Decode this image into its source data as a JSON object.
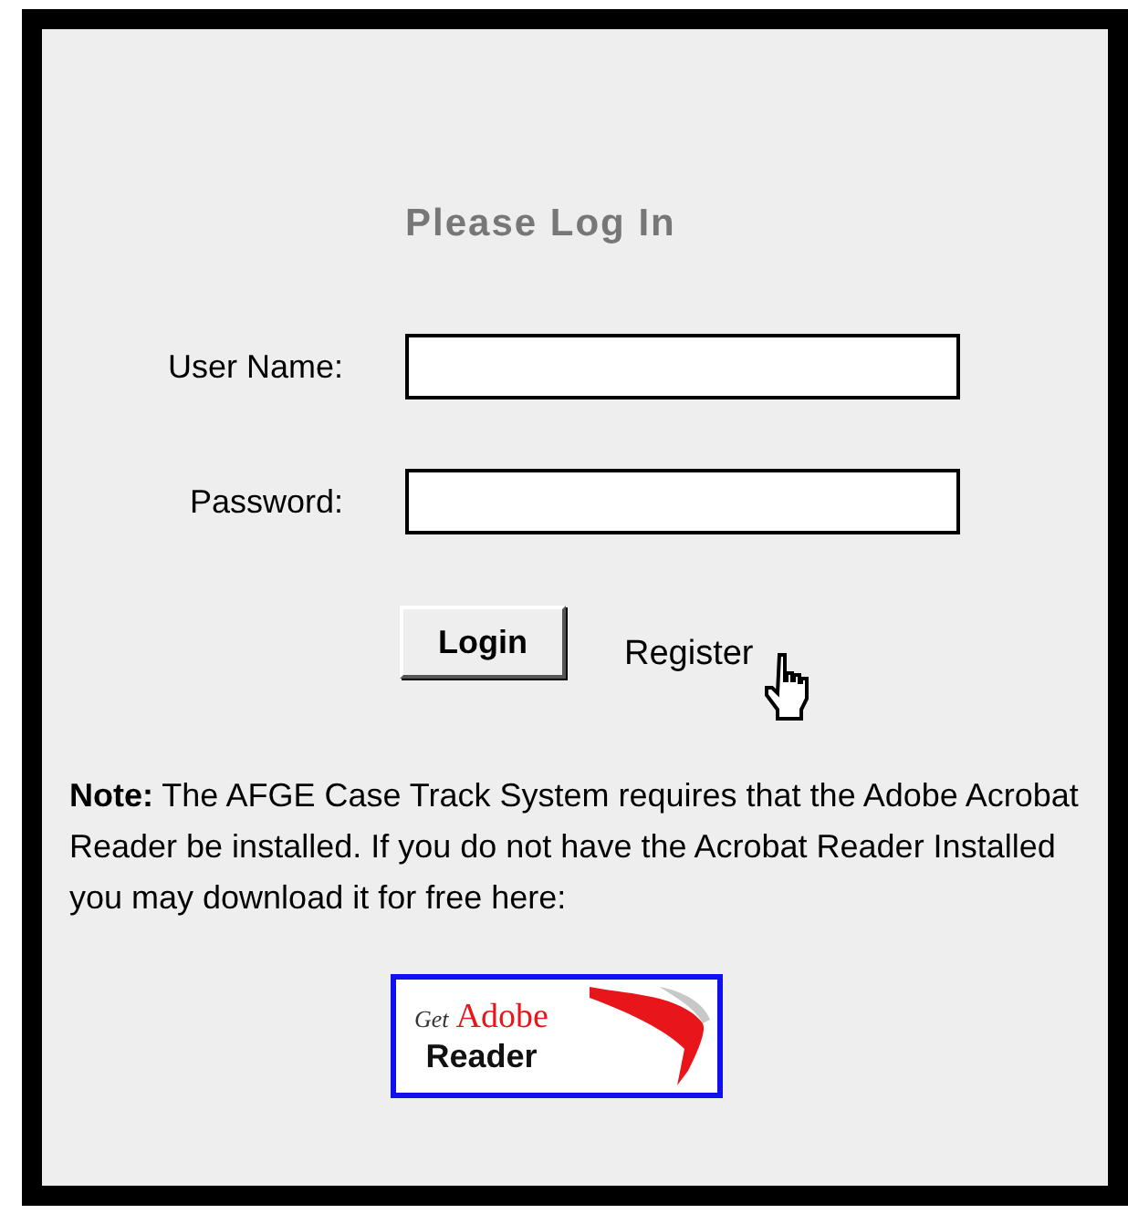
{
  "heading": "Please Log In",
  "fields": [
    {
      "label": "User Name:"
    },
    {
      "label": "Password:"
    }
  ],
  "login_button": "Login",
  "register_link": "Register",
  "note": "**Note:** The AFGE Case Track System requires that the Adobe Acrobat Reader be installed. If you do not have the Acrobat Reader Installed you may download it for free here:",
  "reader_badge": {
    "line_1": "Get",
    "line_2": "Adobe",
    "line_3": "Reader"
  }
}
